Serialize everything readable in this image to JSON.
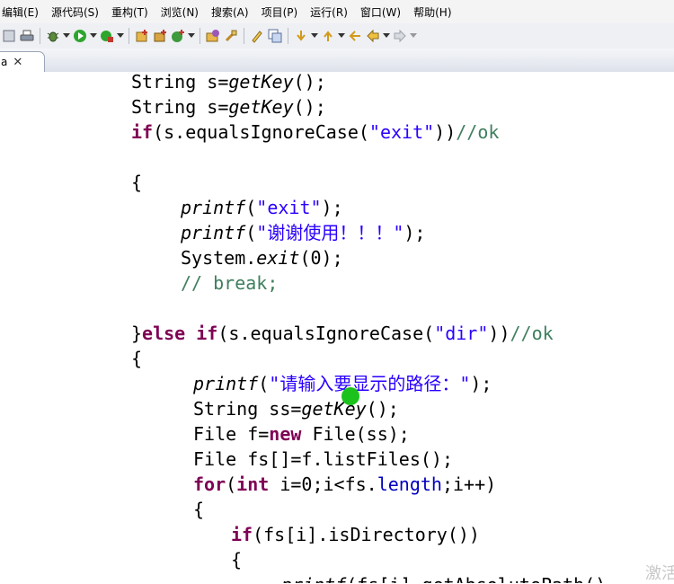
{
  "menu": [
    {
      "label": "编辑(E)"
    },
    {
      "label": "源代码(S)"
    },
    {
      "label": "重构(T)"
    },
    {
      "label": "浏览(N)"
    },
    {
      "label": "搜索(A)"
    },
    {
      "label": "项目(P)"
    },
    {
      "label": "运行(R)"
    },
    {
      "label": "窗口(W)"
    },
    {
      "label": "帮助(H)"
    }
  ],
  "tab": {
    "label": "a",
    "close": "✕"
  },
  "watermark": "激活",
  "colors": {
    "keyword": "#7f0055",
    "string": "#2a00ff",
    "comment": "#3f7f5f",
    "field": "#0000c0",
    "cursor": "#1bc21b"
  }
}
